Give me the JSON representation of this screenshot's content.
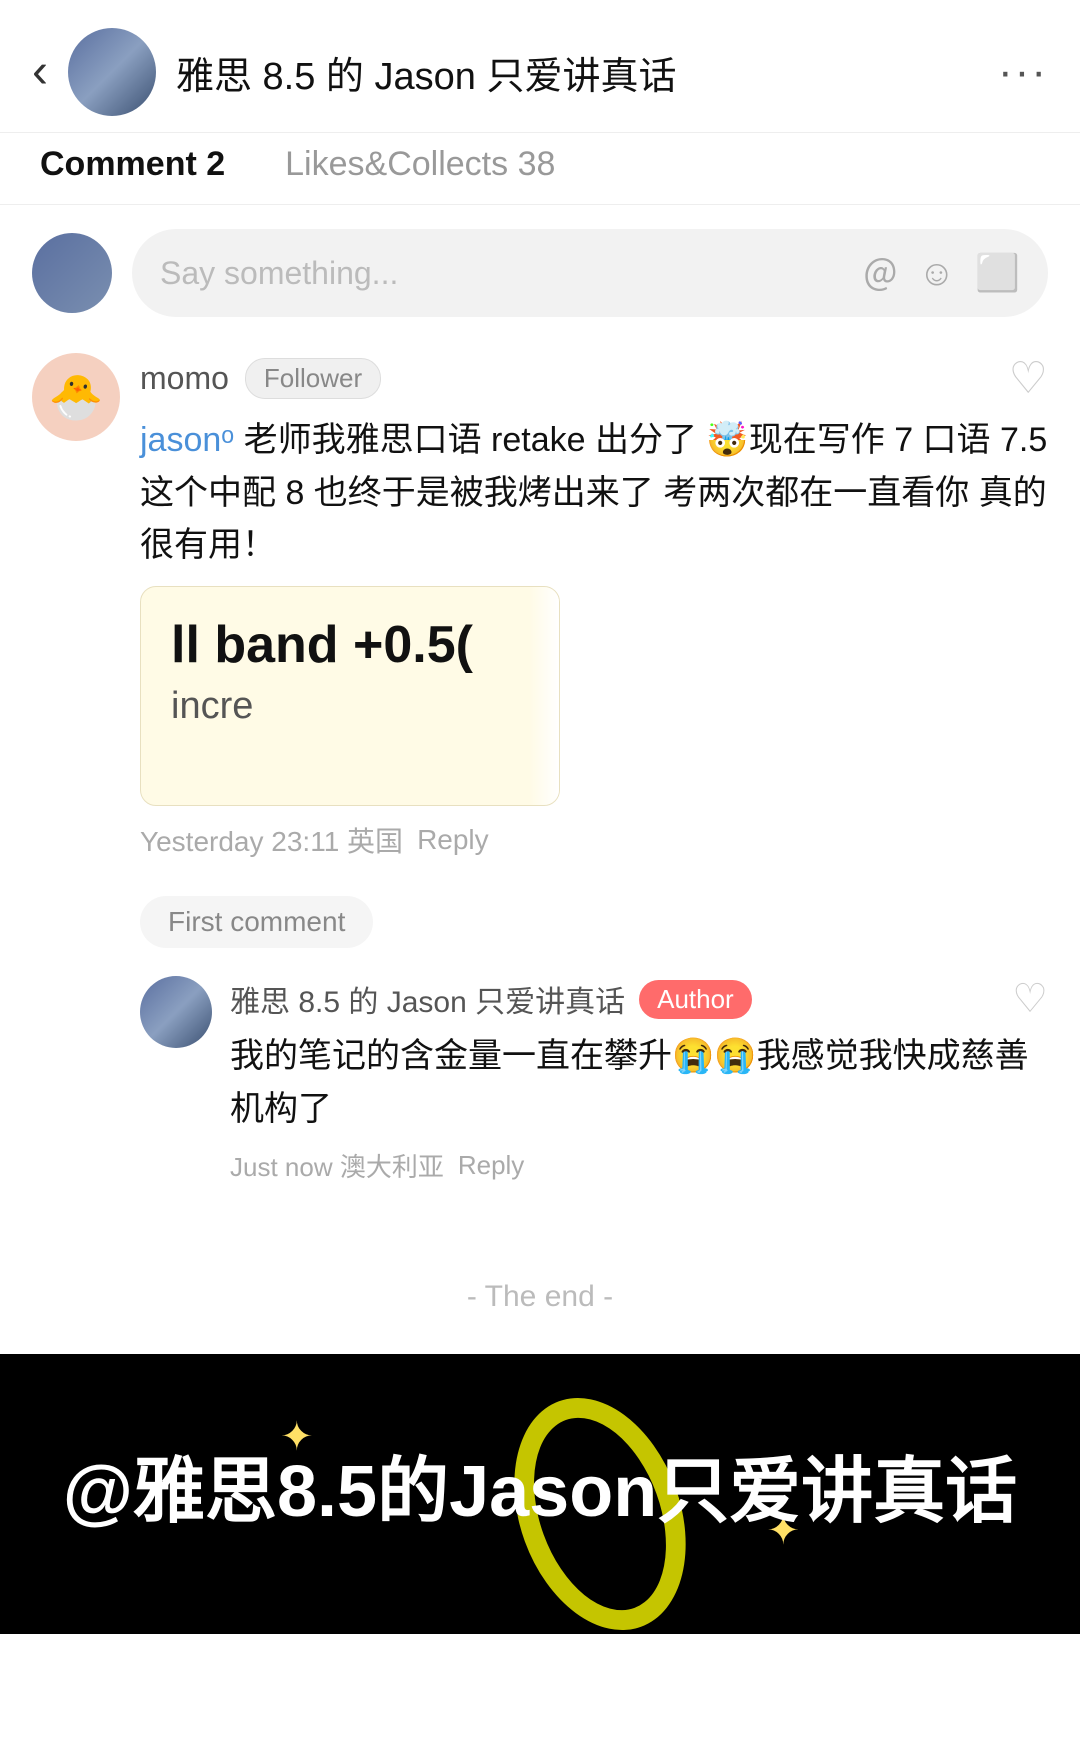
{
  "header": {
    "title": "雅思 8.5 的 Jason 只爱讲真话",
    "back_label": "‹",
    "more_label": "···"
  },
  "tabs": {
    "comment_label": "Comment 2",
    "likes_label": "Likes&Collects 38"
  },
  "comment_input": {
    "placeholder": "Say something..."
  },
  "comments": [
    {
      "id": "comment-1",
      "username": "momo",
      "badge": "Follower",
      "text": "jasonᵒ 老师我雅思口语 retake 出分了 🤯现在写作 7 口语 7.5 这个中配 8 也终于是被我烤出来了  考两次都在一直看你 真的很有用！",
      "score_card": {
        "row1": "ll band   +0.5(",
        "row2": "incre"
      },
      "timestamp": "Yesterday 23:11 英国",
      "reply_label": "Reply",
      "first_comment_label": "First comment",
      "replies": [
        {
          "username": "雅思 8.5 的 Jason 只爱讲真话",
          "badge": "Author",
          "text": "我的笔记的含金量一直在攀升😭😭我感觉我快成慈善机构了",
          "timestamp": "Just now 澳大利亚",
          "reply_label": "Reply"
        }
      ]
    }
  ],
  "the_end": "- The end -",
  "bottom_banner": {
    "text": "@雅思8.5的Jason只爱讲真话"
  }
}
